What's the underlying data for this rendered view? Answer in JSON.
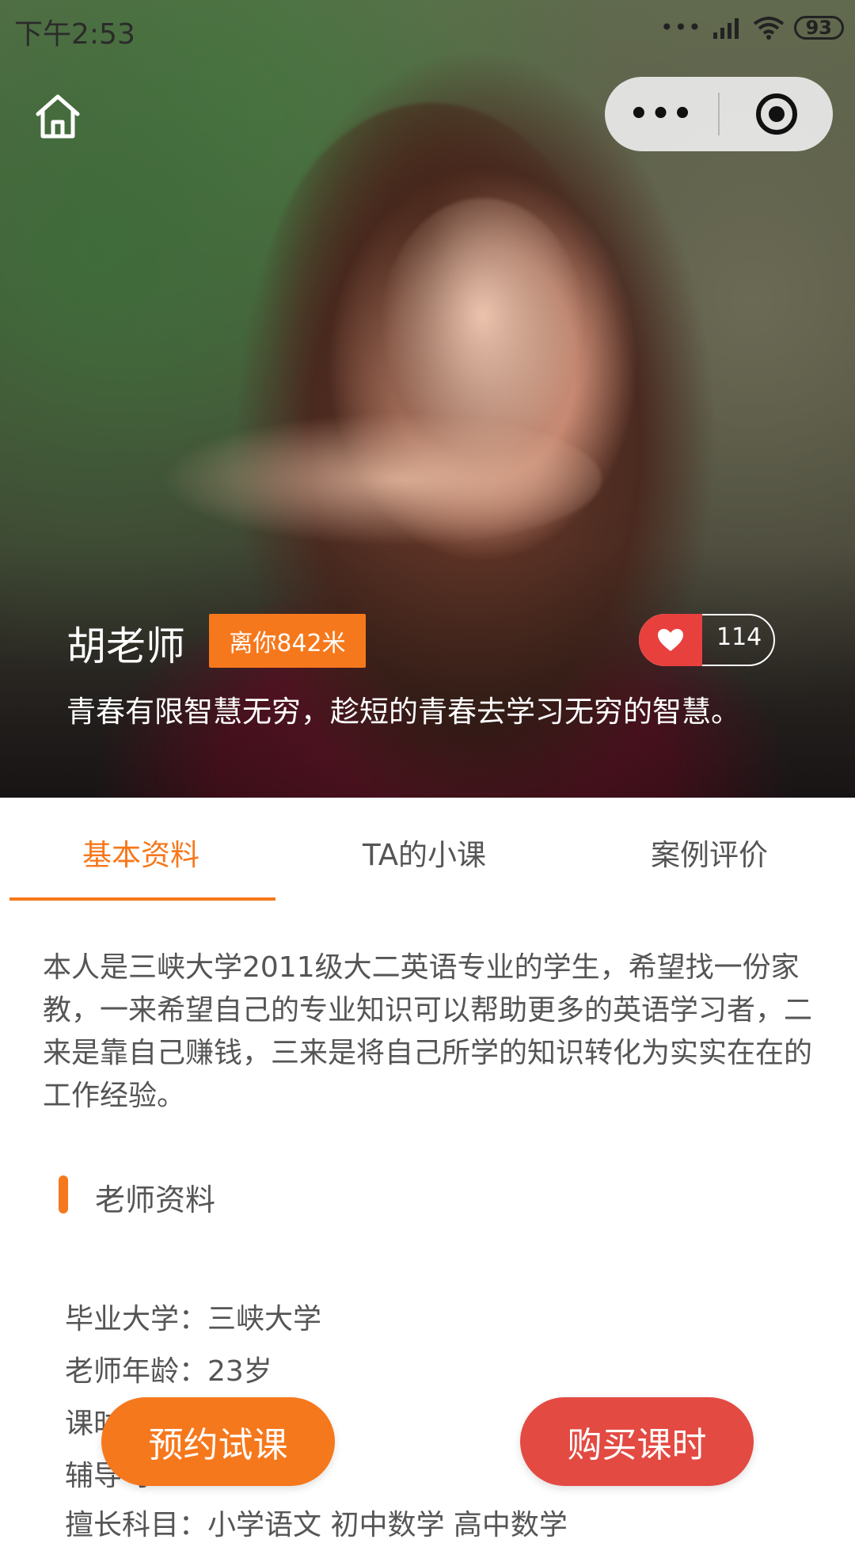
{
  "status_bar": {
    "time": "下午2:53",
    "battery": "93",
    "signal_icons": "••• signal wifi"
  },
  "nav": {
    "home_icon": "home-icon",
    "more_label": "•••",
    "close_icon": "target-circle-icon"
  },
  "profile": {
    "name": "胡老师",
    "distance": "离你842米",
    "likes": "114",
    "motto": "青春有限智慧无穷，趁短的青春去学习无穷的智慧。"
  },
  "tabs": [
    {
      "label": "基本资料",
      "active": true
    },
    {
      "label": "TA的小课",
      "active": false
    },
    {
      "label": "案例评价",
      "active": false
    }
  ],
  "intro": "本人是三峡大学2011级大二英语专业的学生，希望找一份家教，一来希望自己的专业知识可以帮助更多的英语学习者，二来是靠自己赚钱，三来是将自己所学的知识转化为实实在在的工作经验。",
  "section": {
    "title": "老师资料"
  },
  "info_rows": [
    "毕业大学：三峡大学",
    "老师年龄：23岁",
    "课时                    /课时",
    "辅导                        学",
    "擅长科目：小学语文 初中数学 高中数学"
  ],
  "actions": {
    "trial": "预约试课",
    "buy": "购买课时"
  },
  "colors": {
    "accent_orange": "#f6781c",
    "accent_red": "#e34a42",
    "heart_red": "#e8403d"
  }
}
